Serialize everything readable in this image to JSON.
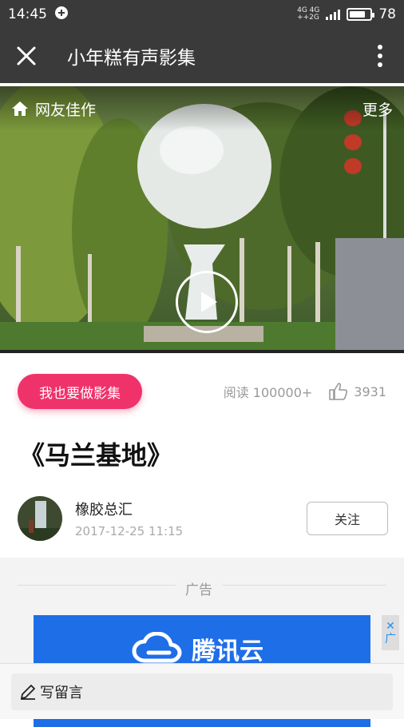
{
  "status": {
    "time": "14:45",
    "network_top": "4G 4G",
    "network_bottom": "++2G",
    "battery": "78",
    "battery_level": 0.78
  },
  "header": {
    "title": "小年糕有声影集"
  },
  "hero": {
    "section_label": "网友佳作",
    "more_label": "更多"
  },
  "actions": {
    "make_button": "我也要做影集",
    "views": "阅读 100000+",
    "likes": "3931"
  },
  "article": {
    "title": "《马兰基地》"
  },
  "author": {
    "name": "橡胶总汇",
    "date": "2017-12-25 11:15",
    "follow_label": "关注"
  },
  "ad": {
    "label": "广告",
    "brand": "腾讯云",
    "close_glyph": "✕",
    "close_text": "广"
  },
  "comment": {
    "label": "写留言"
  },
  "colors": {
    "topbar": "#3a3a3a",
    "accent": "#f0326a",
    "ad_blue": "#1e6ee8"
  },
  "icons": [
    "close-icon",
    "more-vertical-icon",
    "home-icon",
    "play-icon",
    "thumbs-up-icon",
    "pencil-icon",
    "cloud-logo-icon"
  ]
}
